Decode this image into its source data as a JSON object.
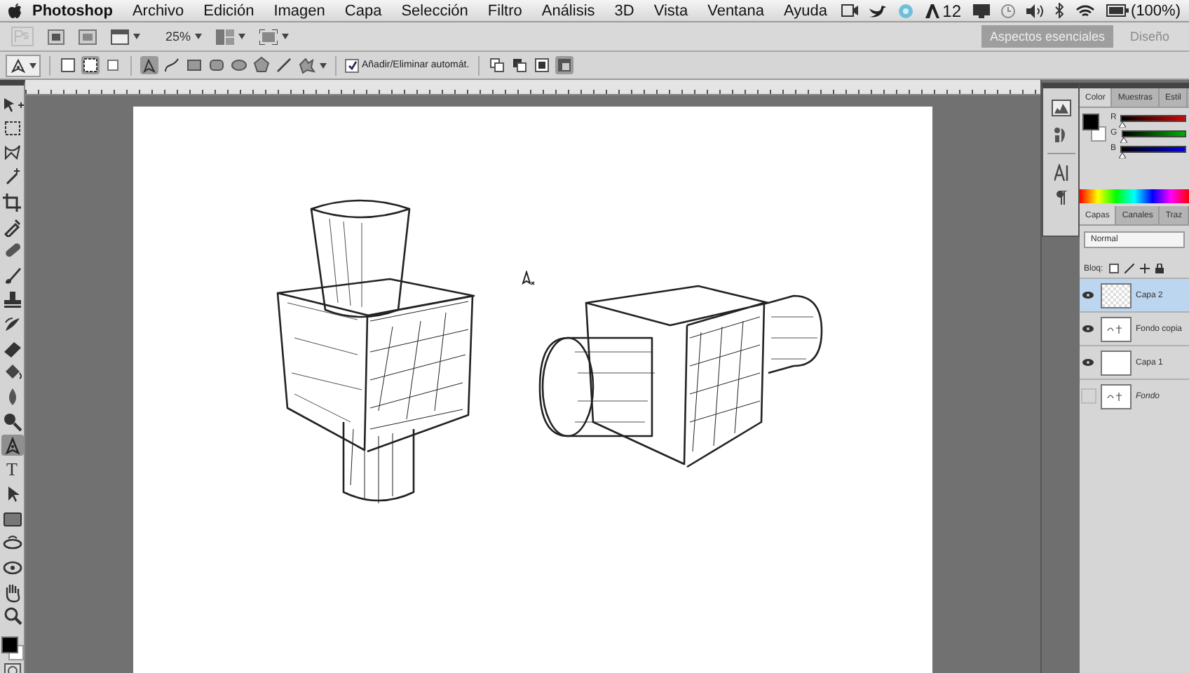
{
  "menu_bar": {
    "app": "Photoshop",
    "items": [
      "Archivo",
      "Edición",
      "Imagen",
      "Capa",
      "Selección",
      "Filtro",
      "Análisis",
      "3D",
      "Vista",
      "Ventana",
      "Ayuda"
    ],
    "badge": "12",
    "battery": "(100%)"
  },
  "app_bar": {
    "zoom": "25%",
    "workspaces": [
      {
        "label": "Aspectos esenciales",
        "selected": true
      },
      {
        "label": "Diseño",
        "selected": false
      }
    ]
  },
  "options_bar": {
    "auto_add": {
      "label": "Añadir/Eliminar automát.",
      "checked": true
    }
  },
  "toolbar": {
    "tools": [
      {
        "kind": "move",
        "selected": false
      },
      {
        "kind": "marquee",
        "selected": false
      },
      {
        "kind": "lasso",
        "selected": false
      },
      {
        "kind": "wand",
        "selected": false
      },
      {
        "kind": "crop",
        "selected": false
      },
      {
        "kind": "eyedropper",
        "selected": false
      },
      {
        "kind": "bandage",
        "selected": false
      },
      {
        "kind": "brush",
        "selected": false
      },
      {
        "kind": "stamp",
        "selected": false
      },
      {
        "kind": "history",
        "selected": false
      },
      {
        "kind": "eraser",
        "selected": false
      },
      {
        "kind": "bucket",
        "selected": false
      },
      {
        "kind": "blur",
        "selected": false
      },
      {
        "kind": "dodge",
        "selected": false
      },
      {
        "kind": "pen",
        "selected": true
      },
      {
        "kind": "type",
        "selected": false,
        "glyph": "T"
      },
      {
        "kind": "select",
        "selected": false
      },
      {
        "kind": "shape",
        "selected": false
      },
      {
        "kind": "rotate3d",
        "selected": false
      },
      {
        "kind": "orbit3d",
        "selected": false
      },
      {
        "kind": "hand",
        "selected": false
      },
      {
        "kind": "zoom",
        "selected": false
      }
    ]
  },
  "color_panel": {
    "tabs": [
      {
        "label": "Color",
        "selected": true
      },
      {
        "label": "Muestras",
        "selected": false
      },
      {
        "label": "Estil",
        "selected": false
      }
    ],
    "channels": [
      {
        "label": "R",
        "level": 0
      },
      {
        "label": "G",
        "level": 0
      },
      {
        "label": "B",
        "level": 0
      }
    ]
  },
  "layers_panel": {
    "tabs": [
      {
        "label": "Capas",
        "selected": true
      },
      {
        "label": "Canales",
        "selected": false
      },
      {
        "label": "Traz",
        "selected": false
      }
    ],
    "blend_mode": "Normal",
    "lock_label": "Bloq:",
    "layers": [
      {
        "name": "Capa 2",
        "visible": true,
        "selected": true,
        "kind": "transparent",
        "italic": false
      },
      {
        "name": "Fondo copia",
        "visible": true,
        "selected": false,
        "kind": "sketch",
        "italic": false
      },
      {
        "name": "Capa 1",
        "visible": true,
        "selected": false,
        "kind": "blank",
        "italic": false
      },
      {
        "name": "Fondo",
        "visible": false,
        "selected": false,
        "kind": "sketch",
        "italic": true
      }
    ]
  }
}
